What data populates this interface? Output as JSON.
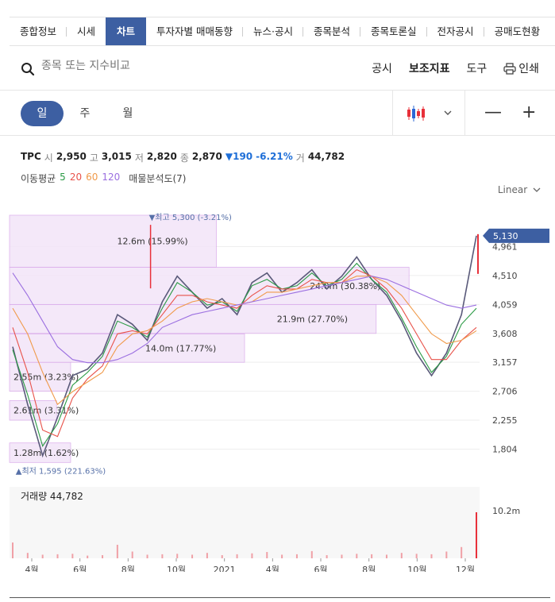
{
  "tabs": [
    "종합정보",
    "시세",
    "차트",
    "투자자별 매매동향",
    "뉴스·공시",
    "종목분석",
    "종목토론실",
    "전자공시",
    "공매도현황"
  ],
  "search": {
    "placeholder": "종목 또는 지수비교"
  },
  "tools": {
    "disclosure": "공시",
    "indicator": "보조지표",
    "tool": "도구",
    "print": "인쇄"
  },
  "periods": [
    "일",
    "주",
    "월"
  ],
  "controls": {
    "minus": "—",
    "plus": "+"
  },
  "quote": {
    "name": "TPC",
    "open_label": "시",
    "open": "2,950",
    "high_label": "고",
    "high": "3,015",
    "low_label": "저",
    "low": "2,820",
    "close_label": "종",
    "close": "2,870",
    "change": "▼190",
    "change_pct": "-6.21%",
    "volume_label": "거",
    "volume": "44,782"
  },
  "moving_average": {
    "label": "이동평균",
    "periods": [
      "5",
      "20",
      "60",
      "120"
    ],
    "period_colors": [
      "#2a9a44",
      "#e8524a",
      "#f09a4a",
      "#9b6fe0"
    ],
    "vp_label": "매물분석도(7)"
  },
  "scale_label": "Linear",
  "colors": {
    "up": "#e8303a",
    "down": "#2c67d6",
    "accent": "#3d5fa2",
    "price_tag": "#3d5fa2",
    "volume_profile": "#f3e4f8"
  },
  "chart_data": {
    "type": "line",
    "title": "TPC",
    "price_axis_ticks": [
      "1,804",
      "2,255",
      "2,706",
      "3,157",
      "3,608",
      "4,059",
      "4,510",
      "4,961"
    ],
    "ylim": [
      1500,
      5450
    ],
    "x_ticks": [
      "4월",
      "6월",
      "8월",
      "10월",
      "2021",
      "4월",
      "6월",
      "8월",
      "10월",
      "12월"
    ],
    "last_price_tag": "5,130",
    "high_marker": {
      "label": "▼최고 5,300 (-3.21%)",
      "value": 5300,
      "x_frac": 0.3
    },
    "low_marker": {
      "label": "▲최저 1,595 (221.63%)",
      "value": 1595,
      "x_frac": 0.03
    },
    "volume_profile": [
      {
        "label": "1.28m (1.62%)",
        "range": [
          1595,
          1900
        ],
        "length": 0.13
      },
      {
        "label": "2.61m (3.31%)",
        "range": [
          2255,
          2560
        ],
        "length": 0.1
      },
      {
        "label": "2.55m (3.23%)",
        "range": [
          2706,
          3157
        ],
        "length": 0.13
      },
      {
        "label": "14.0m (17.77%)",
        "range": [
          3157,
          3600
        ],
        "length": 0.5
      },
      {
        "label": "21.9m (27.70%)",
        "range": [
          3608,
          4059
        ],
        "length": 0.78
      },
      {
        "label": "24.0m (30.38%)",
        "range": [
          4059,
          4640
        ],
        "length": 0.85
      },
      {
        "label": "12.6m (15.99%)",
        "range": [
          4640,
          5450
        ],
        "length": 0.44
      }
    ],
    "series": [
      {
        "name": "종가",
        "kind": "price",
        "values": [
          3400,
          2500,
          1700,
          2300,
          2950,
          3050,
          3300,
          3900,
          3750,
          3500,
          4100,
          4500,
          4250,
          4000,
          4150,
          3900,
          4400,
          4550,
          4250,
          4400,
          4600,
          4300,
          4500,
          4800,
          4450,
          4200,
          3800,
          3300,
          2950,
          3300,
          3900,
          5130
        ]
      },
      {
        "name": "5",
        "kind": "ma",
        "values": [
          3350,
          2650,
          1850,
          2200,
          2800,
          3000,
          3250,
          3800,
          3700,
          3550,
          4000,
          4400,
          4250,
          4050,
          4100,
          3950,
          4350,
          4450,
          4300,
          4350,
          4550,
          4350,
          4450,
          4700,
          4450,
          4250,
          3850,
          3400,
          3000,
          3250,
          3750,
          4000
        ]
      },
      {
        "name": "20",
        "kind": "ma",
        "values": [
          3700,
          3000,
          2100,
          2000,
          2600,
          2900,
          3100,
          3600,
          3650,
          3600,
          3900,
          4200,
          4200,
          4100,
          4050,
          4000,
          4200,
          4350,
          4300,
          4300,
          4450,
          4400,
          4400,
          4600,
          4500,
          4300,
          4000,
          3600,
          3200,
          3200,
          3500,
          3700
        ]
      },
      {
        "name": "60",
        "kind": "ma",
        "values": [
          4000,
          3600,
          3000,
          2500,
          2700,
          2850,
          3000,
          3400,
          3600,
          3650,
          3800,
          4000,
          4100,
          4150,
          4100,
          4050,
          4100,
          4250,
          4250,
          4300,
          4350,
          4400,
          4400,
          4500,
          4500,
          4400,
          4200,
          3900,
          3600,
          3450,
          3500,
          3650
        ]
      },
      {
        "name": "120",
        "kind": "ma",
        "values": [
          4550,
          4200,
          3800,
          3400,
          3200,
          3150,
          3150,
          3200,
          3300,
          3450,
          3700,
          3800,
          3900,
          3950,
          4000,
          4050,
          4100,
          4150,
          4200,
          4250,
          4300,
          4350,
          4400,
          4450,
          4500,
          4450,
          4350,
          4250,
          4150,
          4050,
          4000,
          4050
        ]
      }
    ],
    "volume": {
      "label": "거래량",
      "value": "44,782",
      "axis_tick": "10.2m",
      "values": [
        3.5,
        1.2,
        0.8,
        0.9,
        1.0,
        0.6,
        0.7,
        3.0,
        1.5,
        0.8,
        0.9,
        1.0,
        0.8,
        1.2,
        0.7,
        0.9,
        1.1,
        1.4,
        0.8,
        0.9,
        1.6,
        0.7,
        0.8,
        1.0,
        0.9,
        0.8,
        1.2,
        1.0,
        0.9,
        1.5,
        2.5,
        10.2
      ]
    }
  }
}
